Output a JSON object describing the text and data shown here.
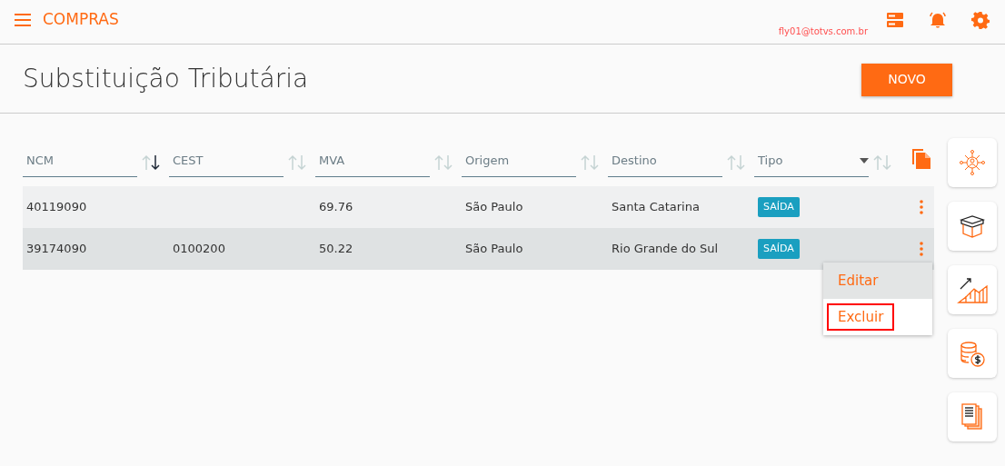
{
  "app_bar": {
    "title": "COMPRAS",
    "user_email": "fly01@totvs.com.br"
  },
  "page": {
    "title": "Substituição Tributária",
    "new_button": "NOVO"
  },
  "table": {
    "columns": [
      {
        "label": "NCM",
        "sorted_desc": true,
        "dropdown": false
      },
      {
        "label": "CEST",
        "sorted_desc": false,
        "dropdown": false
      },
      {
        "label": "MVA",
        "sorted_desc": false,
        "dropdown": false
      },
      {
        "label": "Origem",
        "sorted_desc": false,
        "dropdown": false
      },
      {
        "label": "Destino",
        "sorted_desc": false,
        "dropdown": false
      },
      {
        "label": "Tipo",
        "sorted_desc": false,
        "dropdown": true
      }
    ],
    "rows": [
      {
        "selected": false,
        "cells": [
          "40119090",
          "",
          "69.76",
          "São Paulo",
          "Santa Catarina"
        ],
        "tag": "SAÍDA"
      },
      {
        "selected": true,
        "cells": [
          "39174090",
          "0100200",
          "50.22",
          "São Paulo",
          "Rio Grande do Sul"
        ],
        "tag": "SAÍDA"
      }
    ]
  },
  "row_menu": {
    "items": [
      {
        "label": "Editar",
        "selected": true,
        "outlined": false
      },
      {
        "label": "Excluir",
        "selected": false,
        "outlined": true
      }
    ]
  },
  "side_shortcuts": [
    {
      "kind": "network"
    },
    {
      "kind": "box"
    },
    {
      "kind": "chart"
    },
    {
      "kind": "coins"
    },
    {
      "kind": "documents"
    }
  ]
}
